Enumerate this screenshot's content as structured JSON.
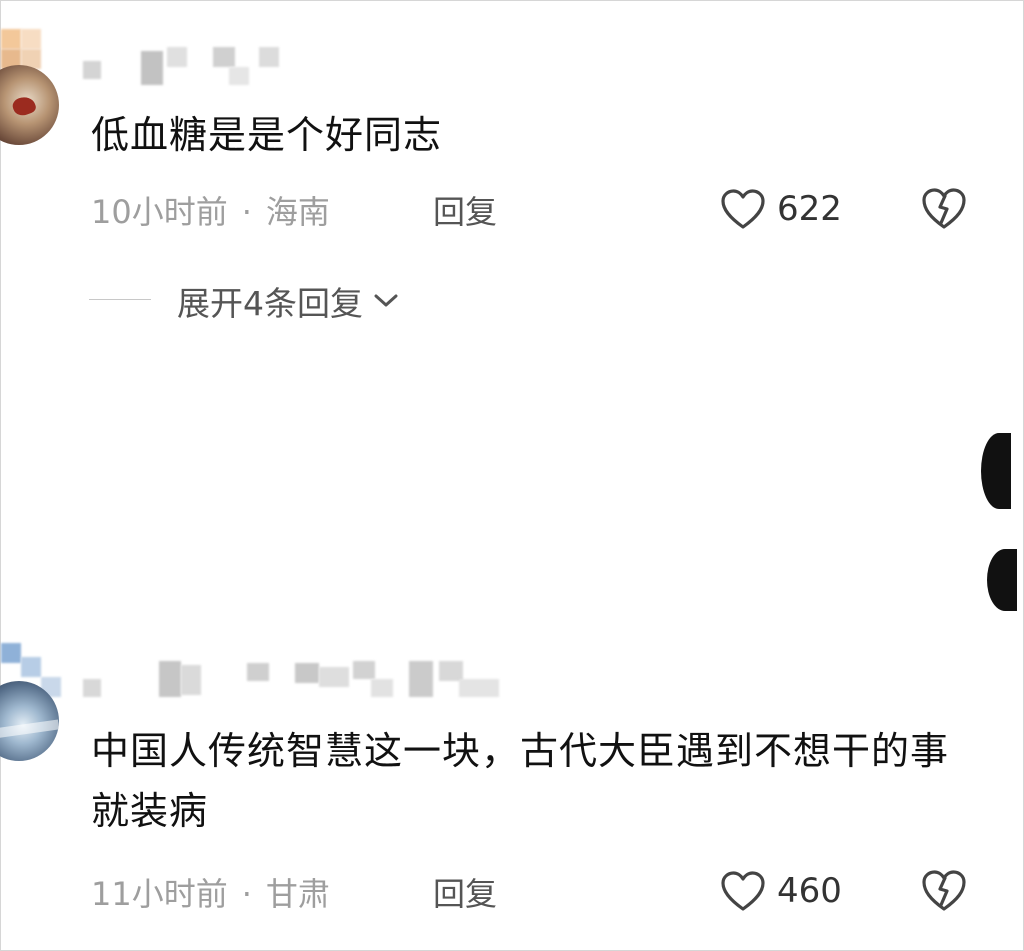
{
  "comments": [
    {
      "text": "低血糖是是个好同志",
      "time": "10小时前",
      "separator": "·",
      "location": "海南",
      "reply_label": "回复",
      "likes": "622",
      "expand_label": "展开4条回复"
    },
    {
      "text": "中国人传统智慧这一块，古代大臣遇到不想干的事就装病",
      "time": "11小时前",
      "separator": "·",
      "location": "甘肃",
      "reply_label": "回复",
      "likes": "460"
    }
  ],
  "icons": {
    "like": "heart-outline-icon",
    "dislike": "broken-heart-icon",
    "expand": "chevron-down-icon"
  },
  "colors": {
    "text_primary": "#111111",
    "text_secondary": "#9e9e9e",
    "text_action": "#555555"
  }
}
